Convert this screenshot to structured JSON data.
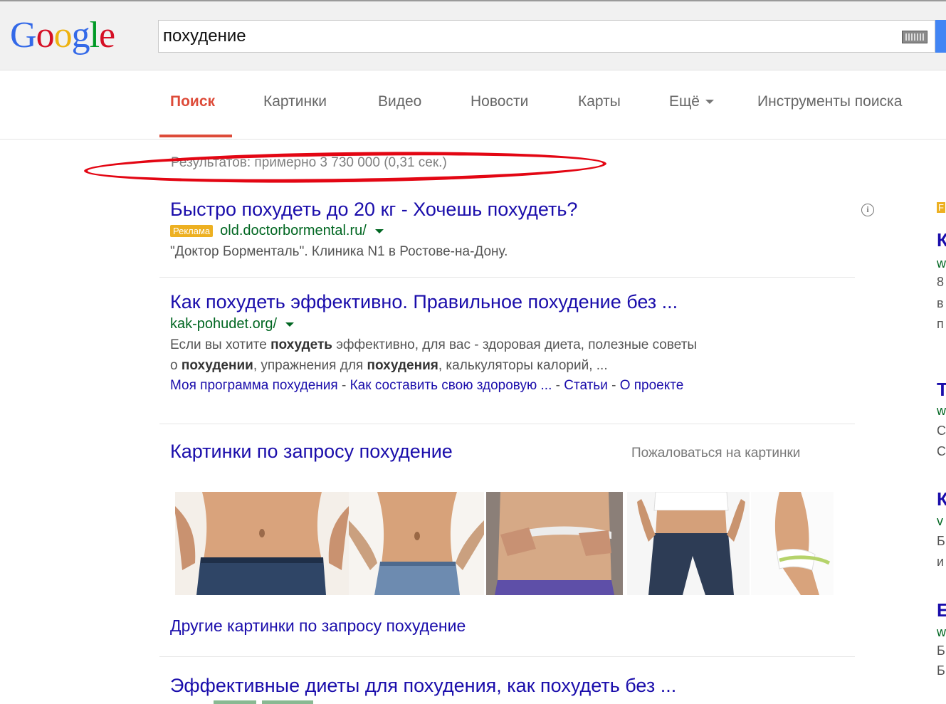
{
  "logo": {
    "letters": [
      "G",
      "o",
      "o",
      "g",
      "l",
      "e"
    ],
    "colors": [
      "#3369e8",
      "#d50f25",
      "#eeb211",
      "#3369e8",
      "#009925",
      "#d50f25"
    ]
  },
  "search": {
    "query": "похудение"
  },
  "tabs": [
    {
      "label": "Поиск",
      "active": true
    },
    {
      "label": "Картинки"
    },
    {
      "label": "Видео"
    },
    {
      "label": "Новости"
    },
    {
      "label": "Карты"
    },
    {
      "label": "Ещё"
    },
    {
      "label": "Инструменты поиска"
    }
  ],
  "stats": "Результатов: примерно 3 730 000 (0,31 сек.)",
  "annotation": {
    "color": "#e30613"
  },
  "results": [
    {
      "title": "Быстро похудеть до 20 кг - Хочешь похудеть?",
      "ad_label": "Реклама",
      "url": "old.doctorbormental.ru/",
      "snippet": "\"Доктор Борменталь\". Клиника N1 в Ростове-на-Дону."
    },
    {
      "title": "Как похудеть эффективно. Правильное похудение без ...",
      "url": "kak-pohudet.org/",
      "snippet1": {
        "a": "Если вы хотите ",
        "b": "похудеть",
        "c": " эффективно, для вас - здоровая диета, полезные советы"
      },
      "snippet2": {
        "a": "о ",
        "b": "похудении",
        "c": ", упражнения для ",
        "d": "похудения",
        "e": ", калькуляторы калорий, ..."
      },
      "sitelinks": [
        "Моя программа похудения",
        "Как составить свою здоровую ...",
        "Статьи",
        "О проекте"
      ]
    }
  ],
  "images_block": {
    "heading": "Картинки по запросу похудение",
    "report": "Пожаловаться на картинки",
    "more": "Другие картинки по запросу похудение"
  },
  "bottom_result": {
    "title": "Эффективные диеты для похудения, как похудеть без ..."
  },
  "right_column_fragments": [
    "F",
    "К",
    "w",
    "8",
    "в",
    "п",
    "Т",
    "w",
    "С",
    "С",
    "К",
    "v",
    "Б",
    "и",
    "Е",
    "w",
    "Б",
    "Б"
  ]
}
